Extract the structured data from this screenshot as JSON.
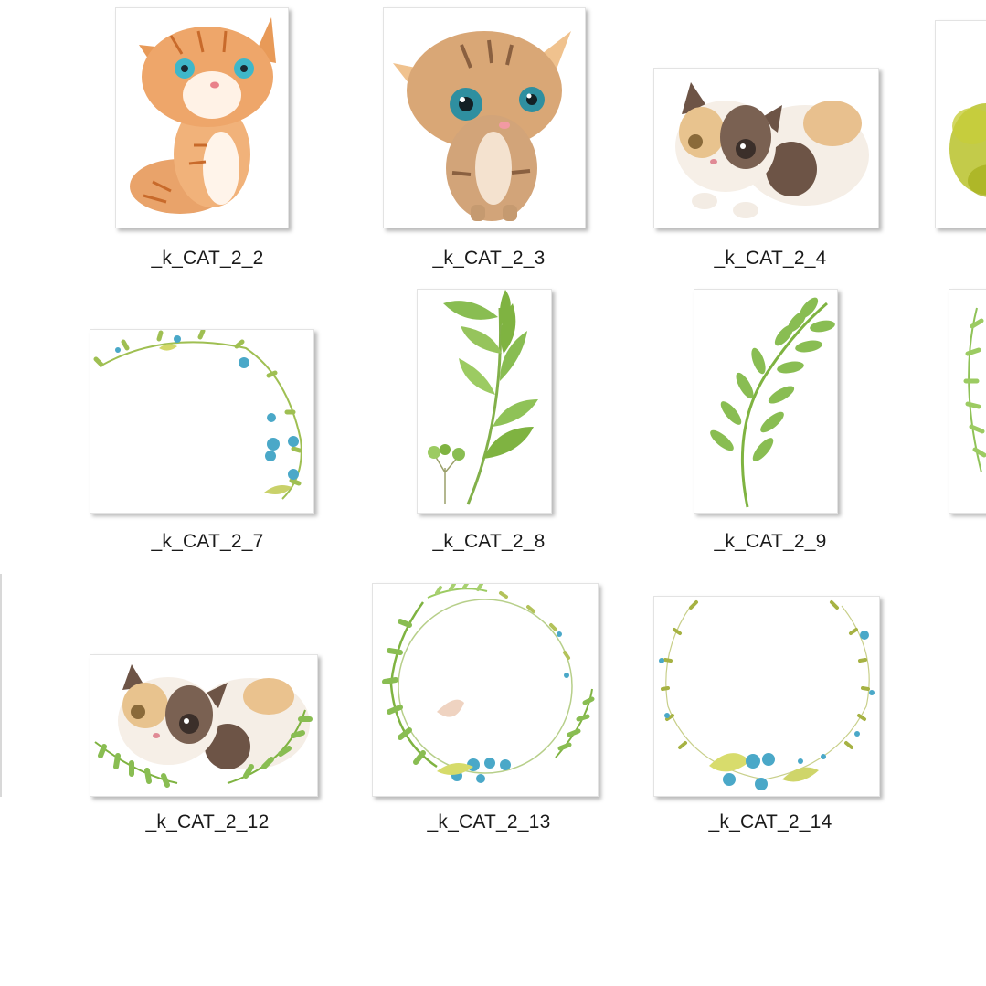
{
  "window": {
    "view": "Large icons",
    "folder_items": [
      {
        "id": "2_2",
        "label": "_k_CAT_2_2",
        "art": "orange-tabby-kitten",
        "icon": "kitten-illustration-icon"
      },
      {
        "id": "2_3",
        "label": "_k_CAT_2_3",
        "art": "tabby-kitten-big-eyes",
        "icon": "kitten-illustration-icon"
      },
      {
        "id": "2_4",
        "label": "_k_CAT_2_4",
        "art": "calico-kitten-lying",
        "icon": "kitten-illustration-icon"
      },
      {
        "id": "2_5",
        "label": "",
        "art": "yellow-green-splash",
        "icon": "watercolor-splash-icon"
      },
      {
        "id": "2_7",
        "label": "_k_CAT_2_7",
        "art": "partial-floral-wreath",
        "icon": "floral-wreath-icon"
      },
      {
        "id": "2_8",
        "label": "_k_CAT_2_8",
        "art": "green-leaf-branch",
        "icon": "leaf-branch-icon"
      },
      {
        "id": "2_9",
        "label": "_k_CAT_2_9",
        "art": "green-fern-branch",
        "icon": "leaf-branch-icon"
      },
      {
        "id": "2_10",
        "label": "",
        "art": "leaf-wreath-partial",
        "icon": "floral-wreath-icon"
      },
      {
        "id": "2_12",
        "label": "_k_CAT_2_12",
        "art": "calico-kitten-with-leaves",
        "icon": "kitten-illustration-icon"
      },
      {
        "id": "2_13",
        "label": "_k_CAT_2_13",
        "art": "green-leaf-wreath",
        "icon": "floral-wreath-icon"
      },
      {
        "id": "2_14",
        "label": "_k_CAT_2_14",
        "art": "blue-berry-wreath",
        "icon": "floral-wreath-icon"
      }
    ]
  },
  "colors": {
    "label_text": "#1a1a1a",
    "leaf_green": "#7fb341",
    "berry_blue": "#4aa8c8",
    "tabby_orange": "#e08a45",
    "calico_brown": "#7a6152",
    "splash_yellow": "#b9c22a"
  }
}
